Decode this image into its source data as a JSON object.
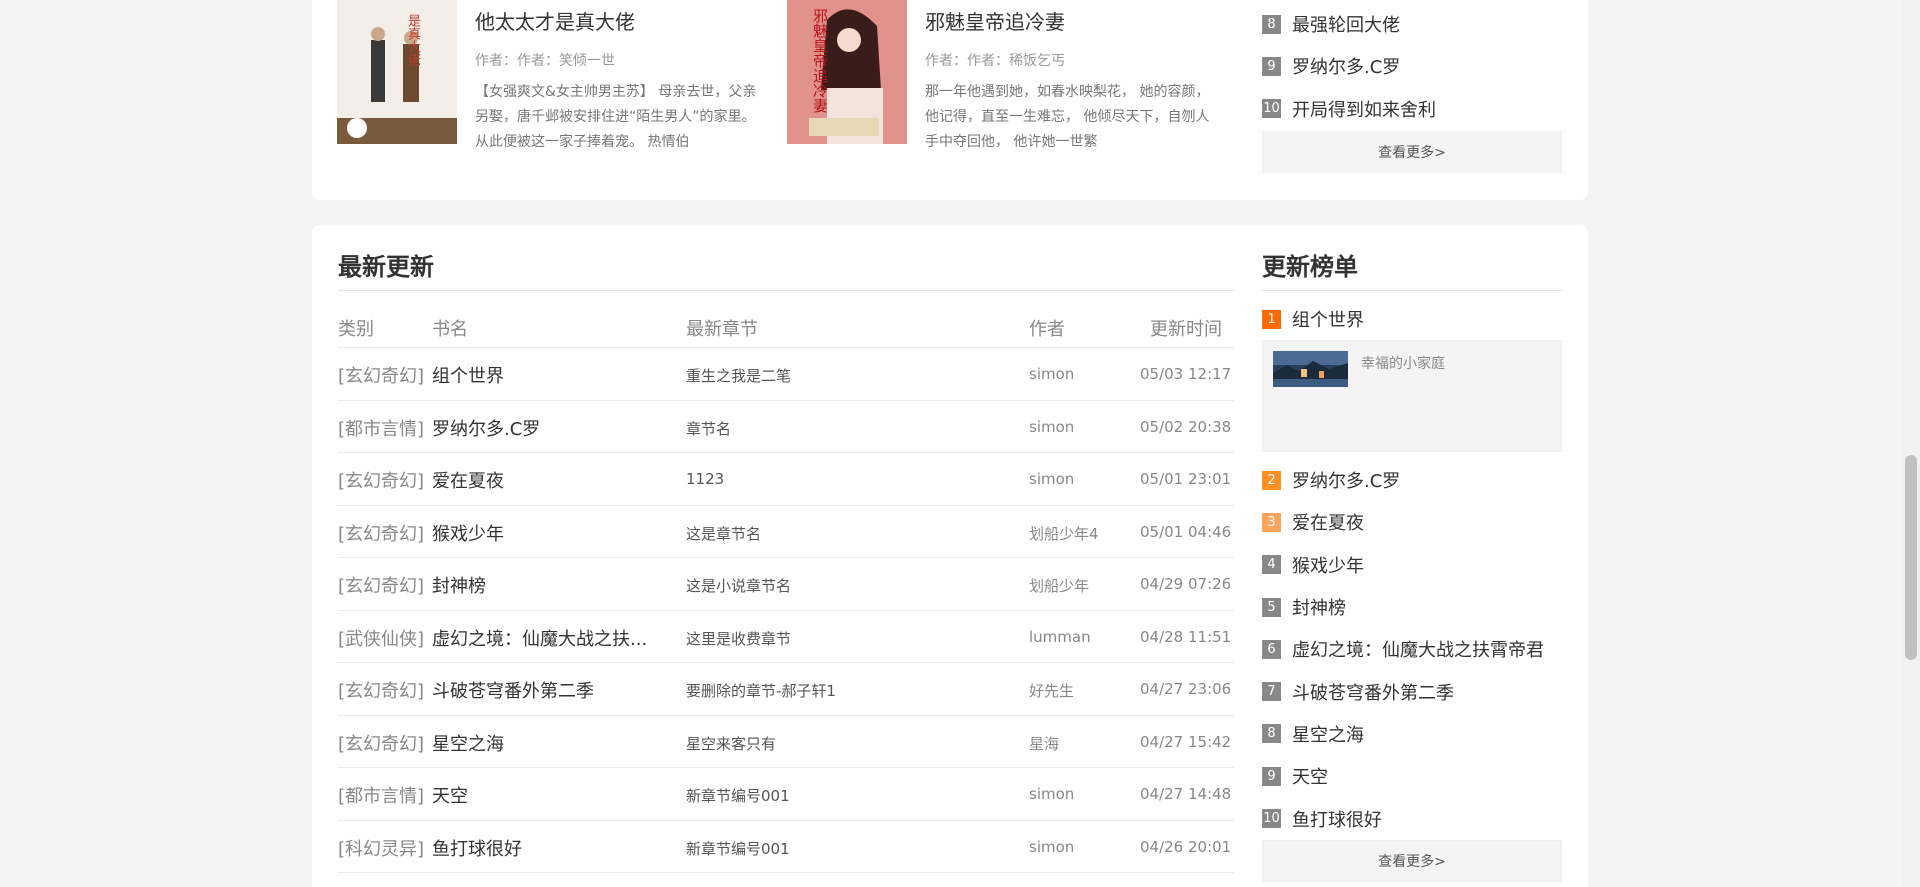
{
  "featured": [
    {
      "title": "他太太才是真大佬",
      "author": "作者：作者：笑倾一世",
      "desc": "【女强爽文&女主帅男主苏】 母亲去世，父亲另娶，唐千邺被安排住进“陌生男人”的家里。 从此便被这一家子捧着宠。 热情伯",
      "cover_text": "是真大佬"
    },
    {
      "title": "邪魅皇帝追冷妻",
      "author": "作者：作者：稀饭乞丐",
      "desc": "那一年他遇到她，如春水映梨花， 她的容颜，他记得，直至一生难忘， 他倾尽天下，自刎人手中夺回他， 他许她一世繁",
      "cover_text": "邪魅皇帝追冷妻"
    }
  ],
  "top_rank": [
    {
      "num": "8",
      "name": "最强轮回大佬"
    },
    {
      "num": "9",
      "name": "罗纳尔多.C罗"
    },
    {
      "num": "10",
      "name": "开局得到如来舍利"
    }
  ],
  "more_label": "查看更多>",
  "latest": {
    "title": "最新更新",
    "headers": {
      "category": "类别",
      "name": "书名",
      "chapter": "最新章节",
      "author": "作者",
      "time": "更新时间"
    },
    "rows": [
      {
        "category": "[玄幻奇幻]",
        "name": "组个世界",
        "chapter": "重生之我是二笔",
        "author": "simon",
        "time": "05/03 12:17"
      },
      {
        "category": "[都市言情]",
        "name": "罗纳尔多.C罗",
        "chapter": "章节名",
        "author": "simon",
        "time": "05/02 20:38"
      },
      {
        "category": "[玄幻奇幻]",
        "name": "爱在夏夜",
        "chapter": "1123",
        "author": "simon",
        "time": "05/01 23:01"
      },
      {
        "category": "[玄幻奇幻]",
        "name": "猴戏少年",
        "chapter": "这是章节名",
        "author": "划船少年4",
        "time": "05/01 04:46"
      },
      {
        "category": "[玄幻奇幻]",
        "name": "封神榜",
        "chapter": "这是小说章节名",
        "author": "划船少年",
        "time": "04/29 07:26"
      },
      {
        "category": "[武侠仙侠]",
        "name": "虚幻之境：仙魔大战之扶...",
        "chapter": "这里是收费章节",
        "author": "lumman",
        "time": "04/28 11:51"
      },
      {
        "category": "[玄幻奇幻]",
        "name": "斗破苍穹番外第二季",
        "chapter": "要删除的章节-郝子轩1",
        "author": "好先生",
        "time": "04/27 23:06"
      },
      {
        "category": "[玄幻奇幻]",
        "name": "星空之海",
        "chapter": "星空来客只有",
        "author": "星海",
        "time": "04/27 15:42"
      },
      {
        "category": "[都市言情]",
        "name": "天空",
        "chapter": "新章节编号001",
        "author": "simon",
        "time": "04/27 14:48"
      },
      {
        "category": "[科幻灵异]",
        "name": "鱼打球很好",
        "chapter": "新章节编号001",
        "author": "simon",
        "time": "04/26 20:01"
      }
    ]
  },
  "update_rank": {
    "title": "更新榜单",
    "first": {
      "num": "1",
      "name": "组个世界",
      "hero_text": "幸福的小家庭"
    },
    "items": [
      {
        "num": "2",
        "name": "罗纳尔多.C罗"
      },
      {
        "num": "3",
        "name": "爱在夏夜"
      },
      {
        "num": "4",
        "name": "猴戏少年"
      },
      {
        "num": "5",
        "name": "封神榜"
      },
      {
        "num": "6",
        "name": "虚幻之境：仙魔大战之扶霄帝君"
      },
      {
        "num": "7",
        "name": "斗破苍穹番外第二季"
      },
      {
        "num": "8",
        "name": "星空之海"
      },
      {
        "num": "9",
        "name": "天空"
      },
      {
        "num": "10",
        "name": "鱼打球很好"
      }
    ]
  },
  "colors": {
    "rank1": "#ff6a00",
    "rank2": "#ff8f1f",
    "rank3": "#ffa45a",
    "rank_other": "#888888"
  }
}
